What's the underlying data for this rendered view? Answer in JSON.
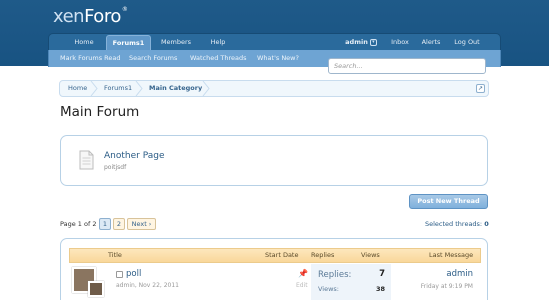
{
  "brand": {
    "prefix": "xen",
    "suffix": "Foro",
    "mark": "®"
  },
  "nav": {
    "tabs": [
      {
        "label": "Home"
      },
      {
        "label": "Forums1",
        "active": true
      },
      {
        "label": "Members"
      },
      {
        "label": "Help"
      }
    ],
    "user": {
      "label": "admin",
      "icon": "chevron-down-icon"
    },
    "right": [
      {
        "label": "Inbox"
      },
      {
        "label": "Alerts"
      },
      {
        "label": "Log Out"
      }
    ]
  },
  "subnav": {
    "links": [
      {
        "label": "Mark Forums Read"
      },
      {
        "label": "Search Forums"
      },
      {
        "label": "Watched Threads"
      },
      {
        "label": "What's New?"
      }
    ],
    "search_placeholder": "Search..."
  },
  "breadcrumb": {
    "items": [
      {
        "label": "Home"
      },
      {
        "label": "Forums1"
      },
      {
        "label": "Main Category"
      }
    ],
    "jump_icon": "jump-to-icon"
  },
  "page": {
    "title": "Main Forum"
  },
  "subforum": {
    "title": "Another Page",
    "description": "poitjsdf",
    "icon": "document-icon"
  },
  "actions": {
    "post_new_thread": "Post New Thread"
  },
  "pagination": {
    "label": "Page 1 of 2",
    "pages": [
      "1",
      "2"
    ],
    "current": "1",
    "next": "Next ›"
  },
  "selection": {
    "label": "Selected threads:",
    "count": "0"
  },
  "thread_list": {
    "headers": {
      "title": "Title",
      "start_date": "Start Date",
      "replies": "Replies",
      "views": "Views",
      "last_message": "Last Message ↓"
    },
    "rows": [
      {
        "title": "poll",
        "author": "admin",
        "date": "Nov 22, 2011",
        "edit": "Edit",
        "replies_label": "Replies:",
        "replies": "7",
        "views_label": "Views:",
        "views": "38",
        "last_user": "admin",
        "last_time": "Friday at 9:19 PM",
        "sticky_icon": "pin-icon"
      }
    ]
  },
  "colors": {
    "header": "#185382",
    "accent": "#2b5c86",
    "thread_header": "#f9d79a"
  }
}
